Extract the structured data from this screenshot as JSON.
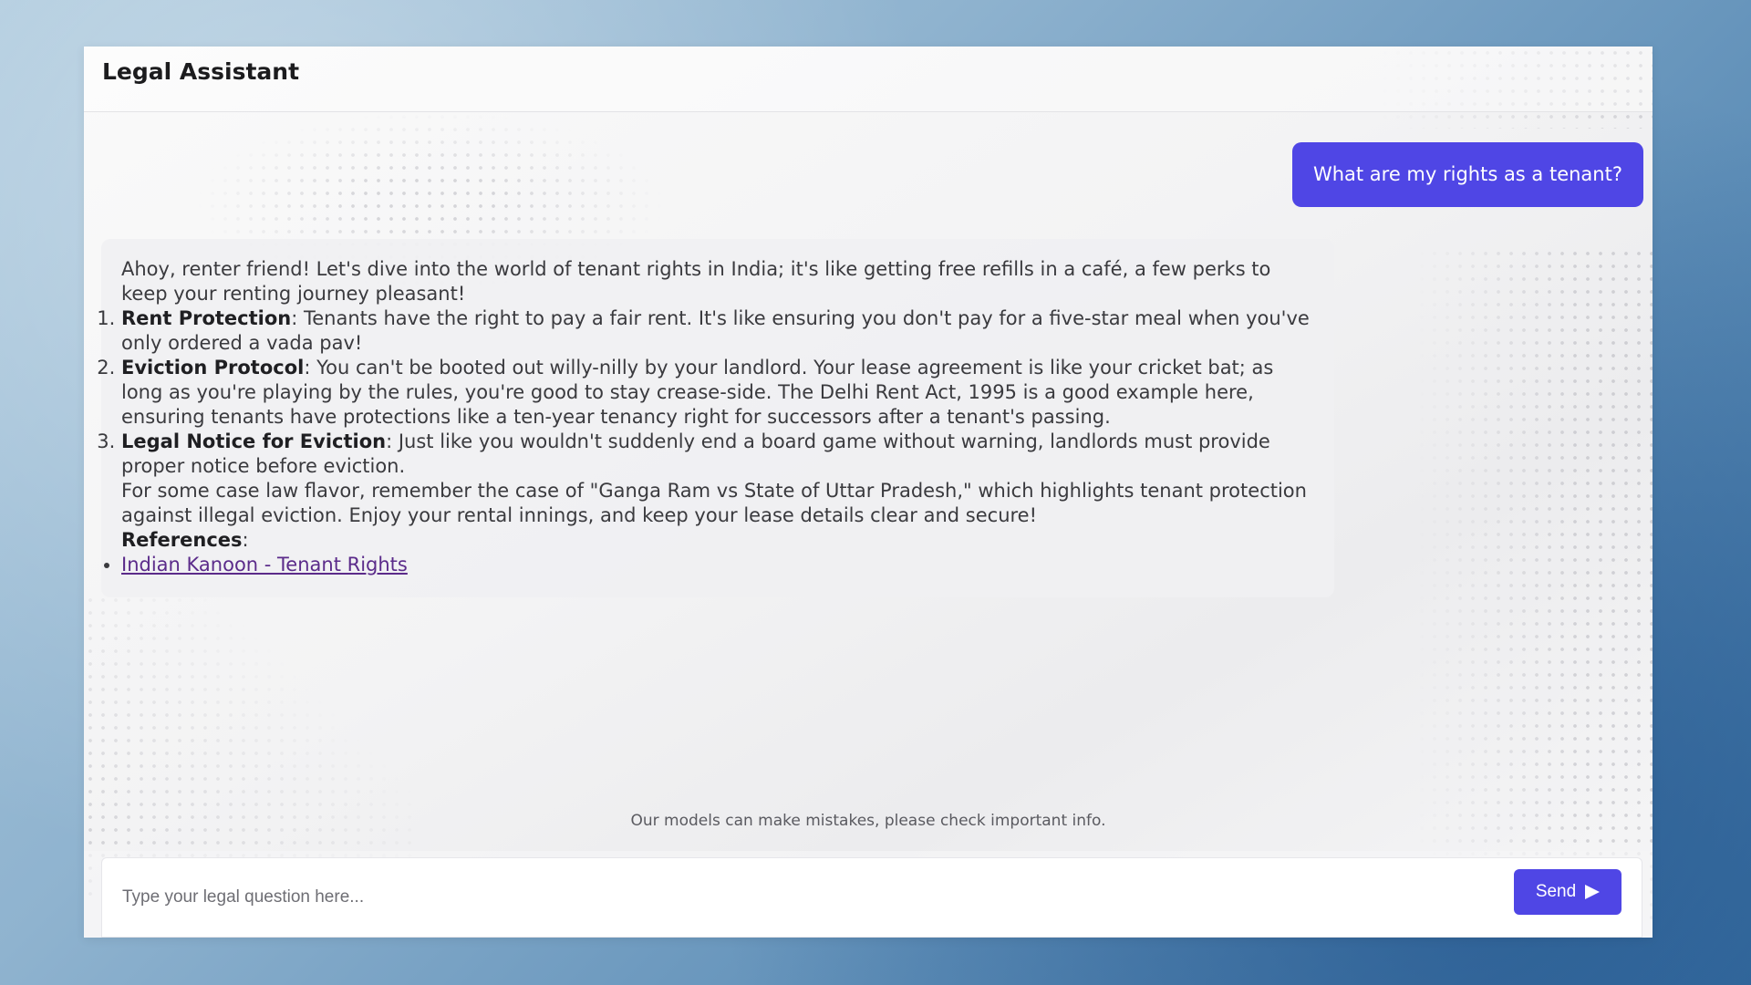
{
  "app": {
    "title": "Legal Assistant"
  },
  "conversation": {
    "user_message": "What are my rights as a tenant?",
    "assistant": {
      "intro": "Ahoy, renter friend! Let's dive into the world of tenant rights in India; it's like getting free refills in a café, a few perks to keep your renting journey pleasant!",
      "points": [
        {
          "title": "Rent Protection",
          "text": ": Tenants have the right to pay a fair rent. It's like ensuring you don't pay for a five-star meal when you've only ordered a vada pav!"
        },
        {
          "title": "Eviction Protocol",
          "text": ": You can't be booted out willy-nilly by your landlord. Your lease agreement is like your cricket bat; as long as you're playing by the rules, you're good to stay crease-side. The Delhi Rent Act, 1995 is a good example here, ensuring tenants have protections like a ten-year tenancy right for successors after a tenant's passing."
        },
        {
          "title": "Legal Notice for Eviction",
          "text": ": Just like you wouldn't suddenly end a board game without warning, landlords must provide proper notice before eviction."
        }
      ],
      "case_law": "For some case law flavor, remember the case of \"Ganga Ram vs State of Uttar Pradesh,\" which highlights tenant protection against illegal eviction. Enjoy your rental innings, and keep your lease details clear and secure!",
      "references_label": "References",
      "references_suffix": ":",
      "references": [
        {
          "label": "Indian Kanoon - Tenant Rights"
        }
      ]
    }
  },
  "disclaimer": "Our models can make mistakes, please check important info.",
  "composer": {
    "placeholder": "Type your legal question here...",
    "value": "",
    "send_label": "Send",
    "send_icon": "send-arrow-icon"
  },
  "colors": {
    "accent": "#4f46e5",
    "link": "#5b2b8a"
  }
}
